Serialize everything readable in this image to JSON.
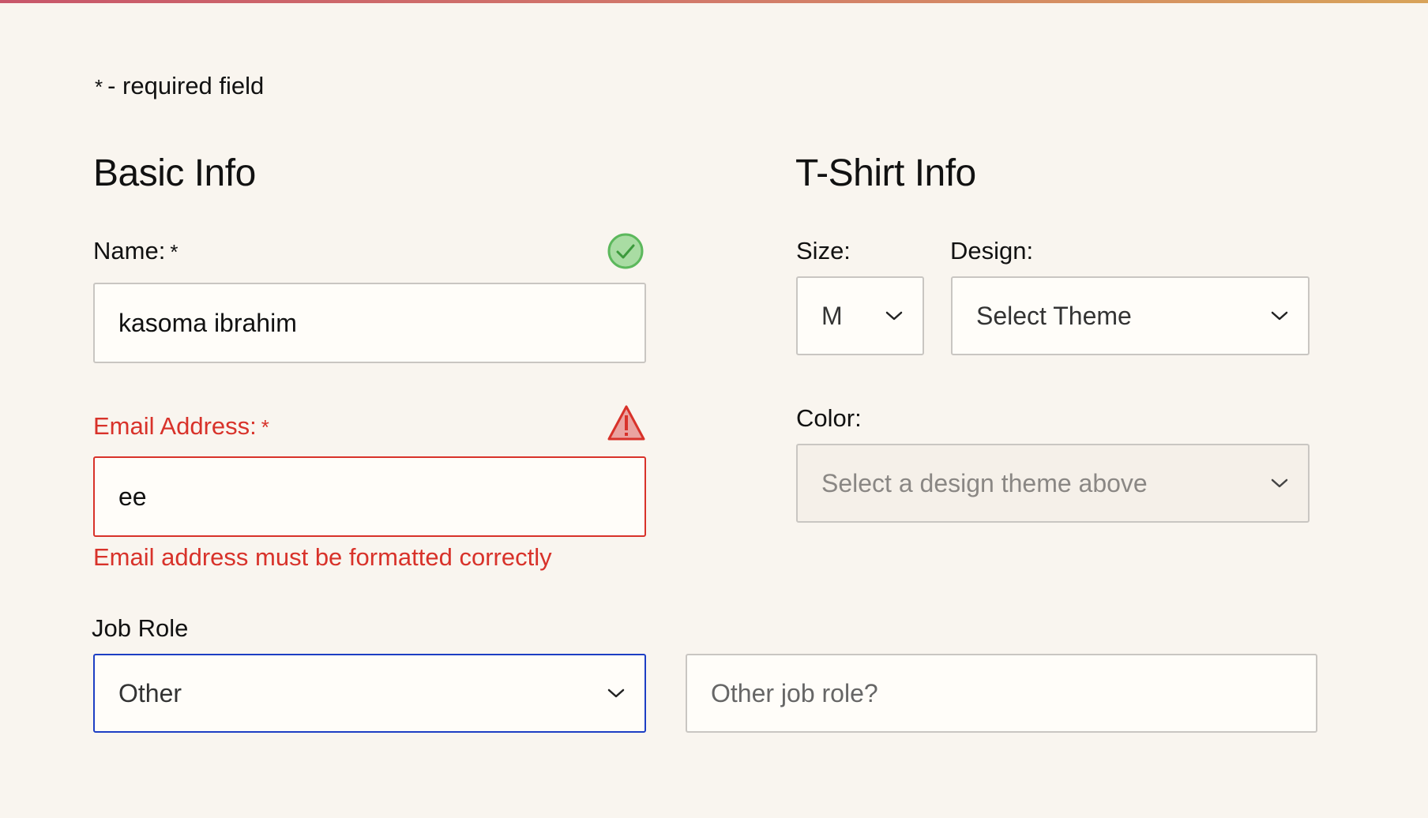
{
  "required_note": {
    "star": "*",
    "text": "- required field"
  },
  "basic_info": {
    "title": "Basic Info",
    "name": {
      "label": "Name:",
      "required_mark": "*",
      "value": "kasoma ibrahim",
      "status_icon": "checkmark-circle-icon",
      "status_color": "#5cb85c"
    },
    "email": {
      "label": "Email Address:",
      "required_mark": "*",
      "value": "ee",
      "status_icon": "warning-triangle-icon",
      "error_color": "#d8322a",
      "error_message": "Email address must be formatted correctly"
    },
    "job_role": {
      "label": "Job Role",
      "selected": "Other",
      "other_placeholder": "Other job role?",
      "focus_color": "#1d3fc4"
    }
  },
  "tshirt_info": {
    "title": "T-Shirt Info",
    "size": {
      "label": "Size:",
      "selected": "M"
    },
    "design": {
      "label": "Design:",
      "selected": "Select Theme"
    },
    "color": {
      "label": "Color:",
      "selected": "Select a design theme above",
      "disabled": true
    }
  }
}
